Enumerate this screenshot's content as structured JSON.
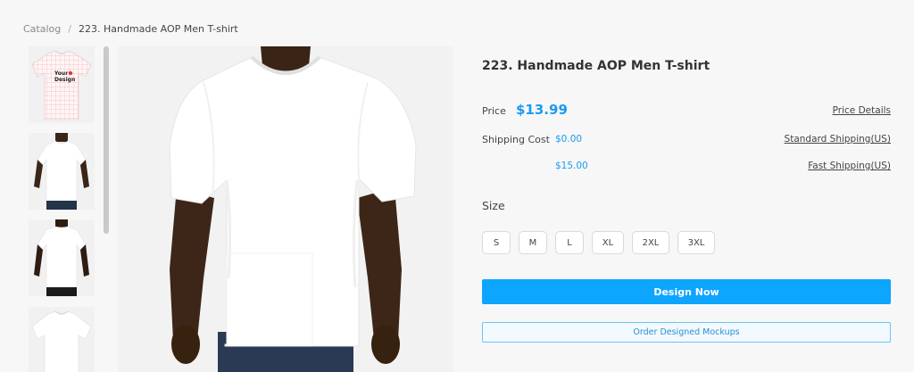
{
  "breadcrumb": {
    "root": "Catalog",
    "separator": "/",
    "current": "223. Handmade AOP Men T-shirt"
  },
  "product": {
    "title": "223. Handmade AOP Men T-shirt",
    "price_label": "Price",
    "price": "$13.99",
    "price_details_link": "Price Details",
    "shipping_label": "Shipping Cost",
    "shipping_standard_cost": "$0.00",
    "shipping_standard_link": "Standard Shipping(US)",
    "shipping_fast_cost": "$15.00",
    "shipping_fast_link": "Fast Shipping(US)"
  },
  "size": {
    "label": "Size",
    "options": [
      "S",
      "M",
      "L",
      "XL",
      "2XL",
      "3XL"
    ]
  },
  "actions": {
    "design_now": "Design Now",
    "order_mockups": "Order Designed Mockups"
  },
  "thumbnails": {
    "first_logo_text_line1": "Your",
    "first_logo_text_line2": "Design"
  },
  "colors": {
    "accent": "#0ea5ff",
    "price": "#1a9bf0"
  }
}
